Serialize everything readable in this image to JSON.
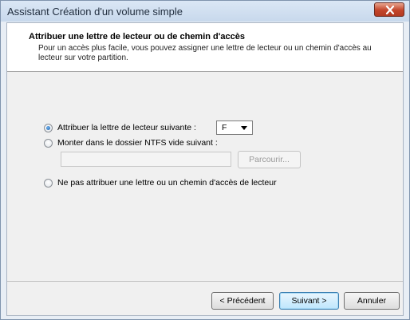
{
  "window": {
    "title": "Assistant Création d'un volume simple"
  },
  "header": {
    "title": "Attribuer une lettre de lecteur ou de chemin d'accès",
    "description": "Pour un accès plus facile, vous pouvez assigner une lettre de lecteur ou un chemin d'accès au lecteur sur votre partition."
  },
  "options": {
    "assign_letter": {
      "label": "Attribuer la lettre de lecteur suivante :",
      "selected": true
    },
    "drive_letter": {
      "value": "F"
    },
    "mount_folder": {
      "label": "Monter dans le dossier NTFS vide suivant :",
      "selected": false,
      "value": ""
    },
    "browse_label": "Parcourir...",
    "no_letter": {
      "label": "Ne pas attribuer une lettre ou un chemin d'accès de lecteur",
      "selected": false
    }
  },
  "buttons": {
    "back": "< Précédent",
    "next": "Suivant >",
    "cancel": "Annuler"
  },
  "icons": {
    "close": "close-icon",
    "dropdown": "chevron-down-icon"
  },
  "colors": {
    "close_button": "#c3452a",
    "default_button_border": "#3c7fb1",
    "radio_dot": "#1d5fa8"
  }
}
